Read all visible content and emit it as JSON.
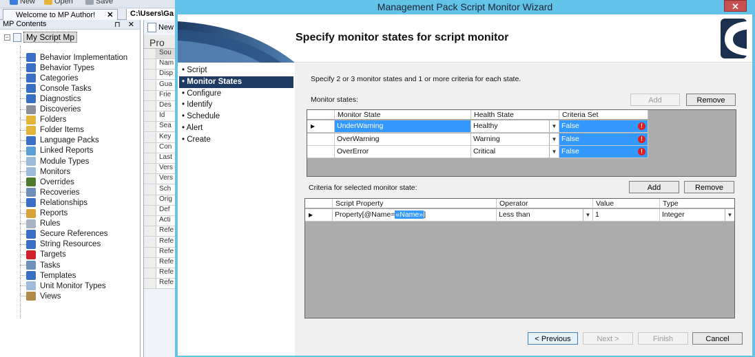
{
  "app": {
    "toolbar": {
      "new_label": "New",
      "open_label": "Open",
      "save_label": "Save"
    },
    "doc_tabs": {
      "tab1": "Welcome to MP Author!",
      "tab1_close": "✕",
      "tab2": "C:\\Users\\Ga"
    },
    "left_pane": {
      "title": "MP Contents",
      "pin": "⊓ ✕",
      "root": "My Script Mp",
      "items": [
        "Behavior Implementation",
        "Behavior Types",
        "Categories",
        "Console Tasks",
        "Diagnostics",
        "Discoveries",
        "Folders",
        "Folder Items",
        "Language Packs",
        "Linked Reports",
        "Module Types",
        "Monitors",
        "Overrides",
        "Recoveries",
        "Relationships",
        "Reports",
        "Rules",
        "Secure References",
        "String Resources",
        "Targets",
        "Tasks",
        "Templates",
        "Unit Monitor Types",
        "Views"
      ]
    },
    "mid_pane": {
      "top_label": "New",
      "prop_header": "Pro",
      "rows": [
        "Sou",
        "Nam",
        "Disp",
        "Gua",
        "Frie",
        "Des",
        "Id",
        "Sea",
        "Key",
        "Con",
        "Last",
        "Vers",
        "Vers",
        "Sch",
        "Orig",
        "Def",
        "Acti",
        "Refe",
        "Refe",
        "Refe",
        "Refe",
        "Refe",
        "Refe"
      ]
    }
  },
  "wizard": {
    "title": "Management Pack Script Monitor Wizard",
    "close": "✕",
    "heading": "Specify monitor states for script monitor",
    "steps": [
      "Script",
      "Monitor States",
      "Configure",
      "Identify",
      "Schedule",
      "Alert",
      "Create"
    ],
    "active_step": "Monitor States",
    "instruction": "Specify 2 or 3 monitor states and 1 or more criteria for each state.",
    "monitor_states": {
      "label": "Monitor states:",
      "add": "Add",
      "remove": "Remove",
      "columns": [
        "Monitor State",
        "Health State",
        "Criteria Set"
      ],
      "rows": [
        {
          "marker": "▶",
          "state": "UnderWarning",
          "health": "Healthy",
          "criteria": "False"
        },
        {
          "marker": "",
          "state": "OverWarning",
          "health": "Warning",
          "criteria": "False"
        },
        {
          "marker": "",
          "state": "OverError",
          "health": "Critical",
          "criteria": "False"
        }
      ]
    },
    "criteria": {
      "label": "Criteria for selected monitor state:",
      "add": "Add",
      "remove": "Remove",
      "columns": [
        "Script Property",
        "Operator",
        "Value",
        "Type"
      ],
      "rows": [
        {
          "marker": "▶",
          "property_prefix": "Property[@Name=",
          "property_token": "«Name»",
          "property_suffix": "]",
          "operator": "Less than",
          "value": "1",
          "type": "Integer"
        }
      ]
    },
    "buttons": {
      "previous": "< Previous",
      "next": "Next >",
      "finish": "Finish",
      "cancel": "Cancel"
    }
  }
}
